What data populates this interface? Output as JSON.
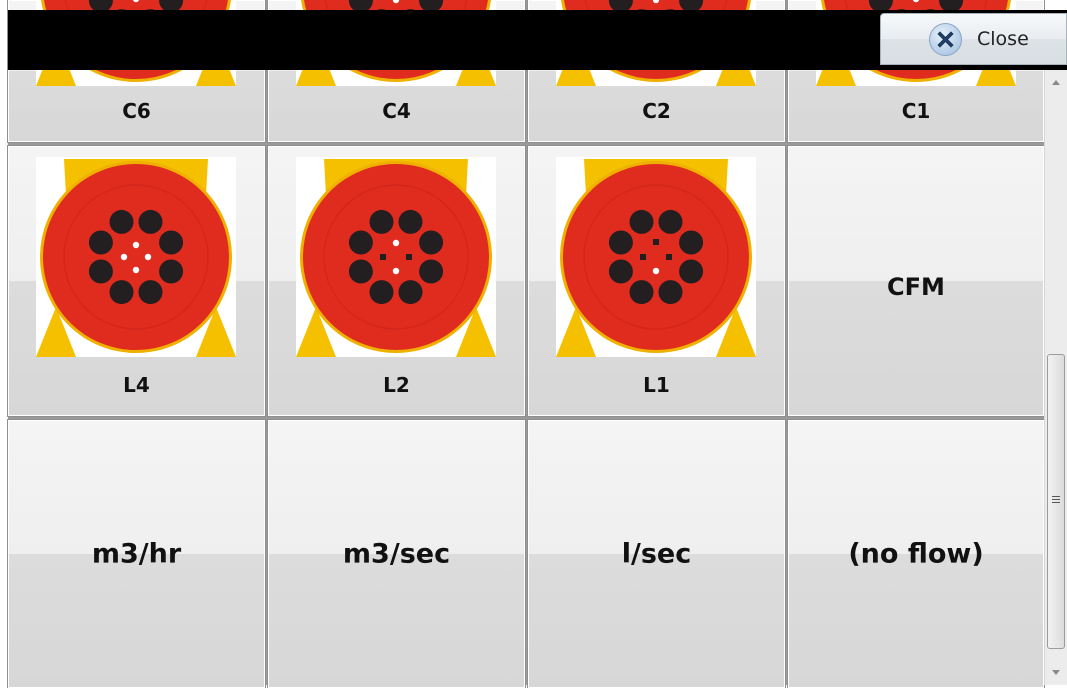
{
  "close_button": {
    "label": "Close",
    "icon": "close-x-icon"
  },
  "rows": [
    {
      "labels": [
        "C6",
        "C4",
        "C2",
        "C1"
      ]
    },
    {
      "labels": [
        "L4",
        "L2",
        "L1",
        "CFM"
      ]
    },
    {
      "labels": [
        "m3/hr",
        "m3/sec",
        "l/sec",
        "(no flow)"
      ]
    }
  ],
  "colors": {
    "connector_red": "#e02b1f",
    "connector_yellow": "#f4c000",
    "pin_black": "#231f20",
    "pin_white": "#ffffff"
  }
}
